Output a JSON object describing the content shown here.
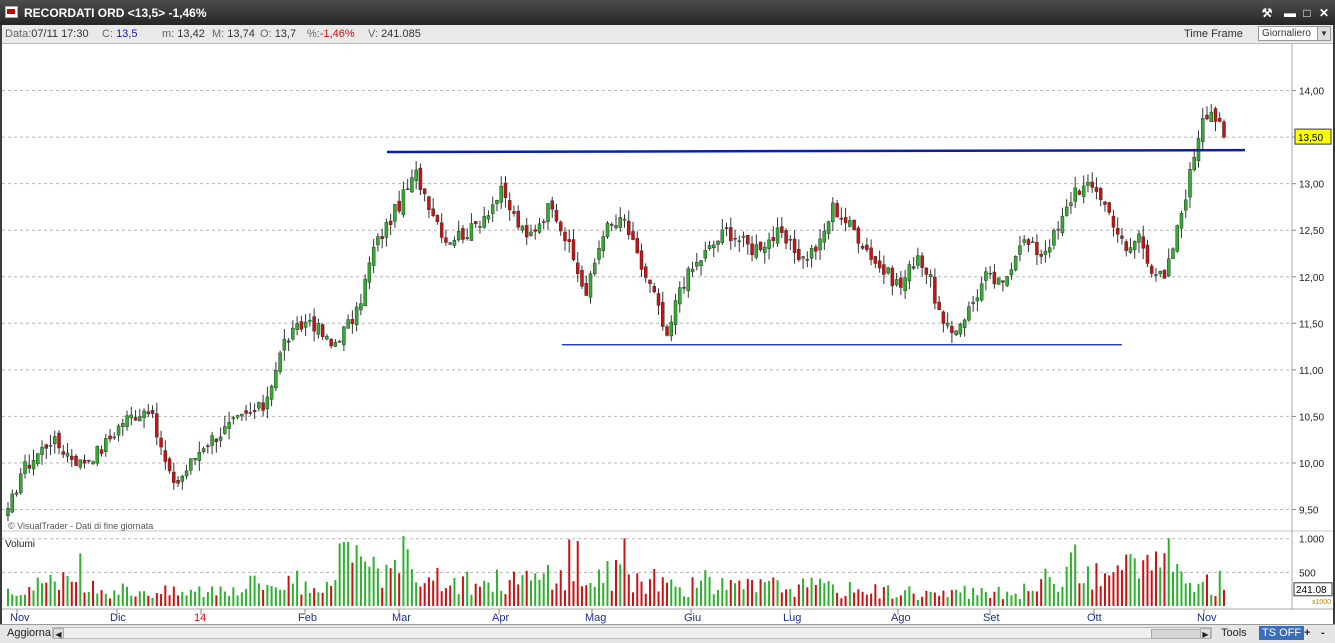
{
  "window": {
    "title": "RECORDATI ORD <13,5> -1,46%"
  },
  "info": {
    "data_label": "Data:",
    "data_value": "07/11 17:30",
    "c_label": "C:",
    "c_value": "13,5",
    "m_label": "m:",
    "m_value": "13,42",
    "M_label": "M:",
    "M_value": "13,74",
    "o_label": "O:",
    "o_value": "13,7",
    "pct_label": "%:",
    "pct_value": "-1,46%",
    "v_label": "V:",
    "v_value": "241.085",
    "time_frame_label": "Time Frame",
    "time_frame_value": "Giornaliero"
  },
  "copyright": "© VisualTrader - Dati di fine giornata",
  "volume_title": "Volumi",
  "current_price_label": "13,50",
  "current_volume_label": "241.08",
  "volume_multiplier": "x1000",
  "bottom": {
    "refresh": "Aggiorna",
    "tools": "Tools",
    "ts": "TS OFF",
    "plus": "+",
    "minus": "-"
  },
  "colors": {
    "up": "#2db12d",
    "down": "#cc1111",
    "trendline": "#0a1fb0",
    "price_tag": "#ffff00"
  },
  "chart_data": {
    "type": "candlestick",
    "price_axis": {
      "ticks": [
        "14,00",
        "13,50",
        "13,00",
        "12,50",
        "12,00",
        "11,50",
        "11,00",
        "10,50",
        "10,00",
        "9,50"
      ],
      "range": [
        9.28,
        14.5
      ]
    },
    "volume_axis": {
      "ticks": [
        "1.000",
        "500"
      ],
      "range": [
        0,
        1100
      ]
    },
    "x_labels": [
      "Nov",
      "Dic",
      "14",
      "Feb",
      "Mar",
      "Apr",
      "Mag",
      "Giu",
      "Lug",
      "Ago",
      "Set",
      "Ott",
      "Nov"
    ],
    "key_points": [
      [
        0,
        9.45
      ],
      [
        3,
        9.9
      ],
      [
        10,
        10.25
      ],
      [
        17,
        10.0
      ],
      [
        22,
        10.15
      ],
      [
        27,
        10.45
      ],
      [
        33,
        10.6
      ],
      [
        38,
        9.85
      ],
      [
        40,
        9.8
      ],
      [
        46,
        10.2
      ],
      [
        54,
        10.45
      ],
      [
        60,
        10.6
      ],
      [
        65,
        11.3
      ],
      [
        71,
        11.55
      ],
      [
        76,
        11.25
      ],
      [
        82,
        11.6
      ],
      [
        86,
        12.3
      ],
      [
        91,
        12.7
      ],
      [
        96,
        13.1
      ],
      [
        98,
        12.9
      ],
      [
        103,
        12.4
      ],
      [
        109,
        12.5
      ],
      [
        116,
        12.9
      ],
      [
        122,
        12.4
      ],
      [
        128,
        12.8
      ],
      [
        132,
        12.3
      ],
      [
        136,
        11.8
      ],
      [
        140,
        12.5
      ],
      [
        145,
        12.6
      ],
      [
        148,
        12.2
      ],
      [
        152,
        11.8
      ],
      [
        155,
        11.3
      ],
      [
        158,
        11.9
      ],
      [
        163,
        12.2
      ],
      [
        169,
        12.5
      ],
      [
        175,
        12.3
      ],
      [
        181,
        12.45
      ],
      [
        187,
        12.2
      ],
      [
        191,
        12.35
      ],
      [
        194,
        12.75
      ],
      [
        199,
        12.5
      ],
      [
        205,
        12.1
      ],
      [
        210,
        11.9
      ],
      [
        214,
        12.25
      ],
      [
        217,
        11.95
      ],
      [
        220,
        11.45
      ],
      [
        222,
        11.4
      ],
      [
        226,
        11.65
      ],
      [
        230,
        12.0
      ],
      [
        234,
        11.9
      ],
      [
        238,
        12.4
      ],
      [
        243,
        12.25
      ],
      [
        247,
        12.5
      ],
      [
        251,
        12.95
      ],
      [
        256,
        12.95
      ],
      [
        260,
        12.6
      ],
      [
        263,
        12.25
      ],
      [
        266,
        12.45
      ],
      [
        269,
        12.1
      ],
      [
        272,
        11.95
      ],
      [
        275,
        12.5
      ],
      [
        278,
        13.1
      ],
      [
        281,
        13.75
      ],
      [
        283,
        13.8
      ],
      [
        286,
        13.5
      ]
    ],
    "volume_samples": [
      [
        0,
        180
      ],
      [
        10,
        320
      ],
      [
        20,
        250
      ],
      [
        33,
        230
      ],
      [
        40,
        190
      ],
      [
        55,
        300
      ],
      [
        64,
        350
      ],
      [
        72,
        270
      ],
      [
        78,
        660
      ],
      [
        86,
        520
      ],
      [
        96,
        560
      ],
      [
        102,
        340
      ],
      [
        110,
        360
      ],
      [
        120,
        380
      ],
      [
        130,
        420
      ],
      [
        136,
        400
      ],
      [
        145,
        500
      ],
      [
        150,
        380
      ],
      [
        160,
        280
      ],
      [
        170,
        270
      ],
      [
        180,
        300
      ],
      [
        190,
        280
      ],
      [
        200,
        230
      ],
      [
        210,
        220
      ],
      [
        220,
        170
      ],
      [
        232,
        180
      ],
      [
        240,
        230
      ],
      [
        245,
        420
      ],
      [
        252,
        560
      ],
      [
        258,
        380
      ],
      [
        262,
        640
      ],
      [
        268,
        500
      ],
      [
        272,
        650
      ],
      [
        276,
        420
      ],
      [
        286,
        241
      ]
    ]
  }
}
